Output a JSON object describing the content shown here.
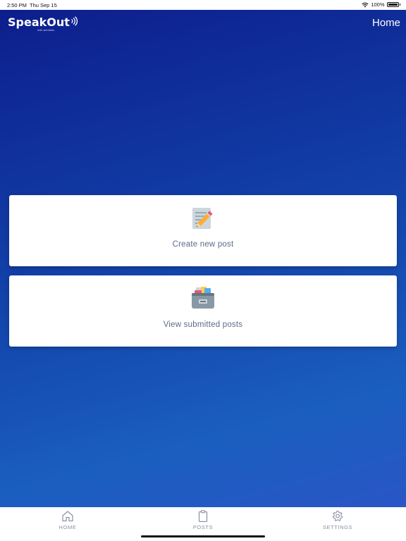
{
  "status_bar": {
    "time": "2:50 PM",
    "date": "Thu Sep 15",
    "battery": "100%"
  },
  "header": {
    "logo_text": "SpeakOut",
    "logo_subtext": "with wendeds",
    "title": "Home"
  },
  "cards": [
    {
      "label": "Create new post",
      "icon": "memo-pencil-icon"
    },
    {
      "label": "View submitted posts",
      "icon": "card-file-box-icon"
    }
  ],
  "tabbar": {
    "items": [
      {
        "label": "HOME",
        "icon": "home-icon"
      },
      {
        "label": "POSTS",
        "icon": "clipboard-icon"
      },
      {
        "label": "SETTINGS",
        "icon": "gear-icon"
      }
    ]
  },
  "colors": {
    "gradient_top": "#0d1e8c",
    "gradient_bottom": "#2a56c6",
    "card_text": "#5f6a8a",
    "tab_text": "#8a90a3"
  }
}
